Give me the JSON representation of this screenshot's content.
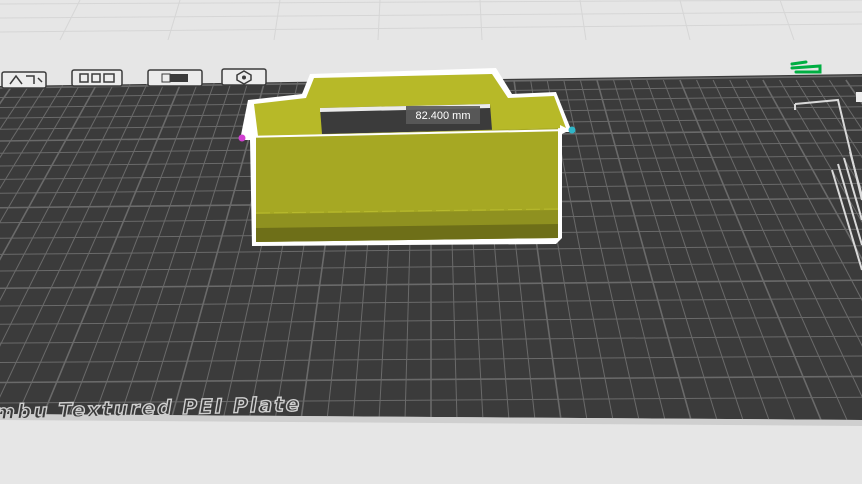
{
  "plate": {
    "name": "mbu Textured PEI Plate"
  },
  "measurement": {
    "label": "82.400 mm"
  },
  "toolbar": {
    "tools": [
      {
        "name": "auto-orient-icon"
      },
      {
        "name": "arrange-icon"
      },
      {
        "name": "plate-icon"
      },
      {
        "name": "settings-icon"
      }
    ]
  },
  "colors": {
    "model": "#a6a823",
    "bed": "#3b3b3b",
    "grid": "#6a6a6a",
    "outline": "#ffffff",
    "accent": "#00ae42"
  }
}
